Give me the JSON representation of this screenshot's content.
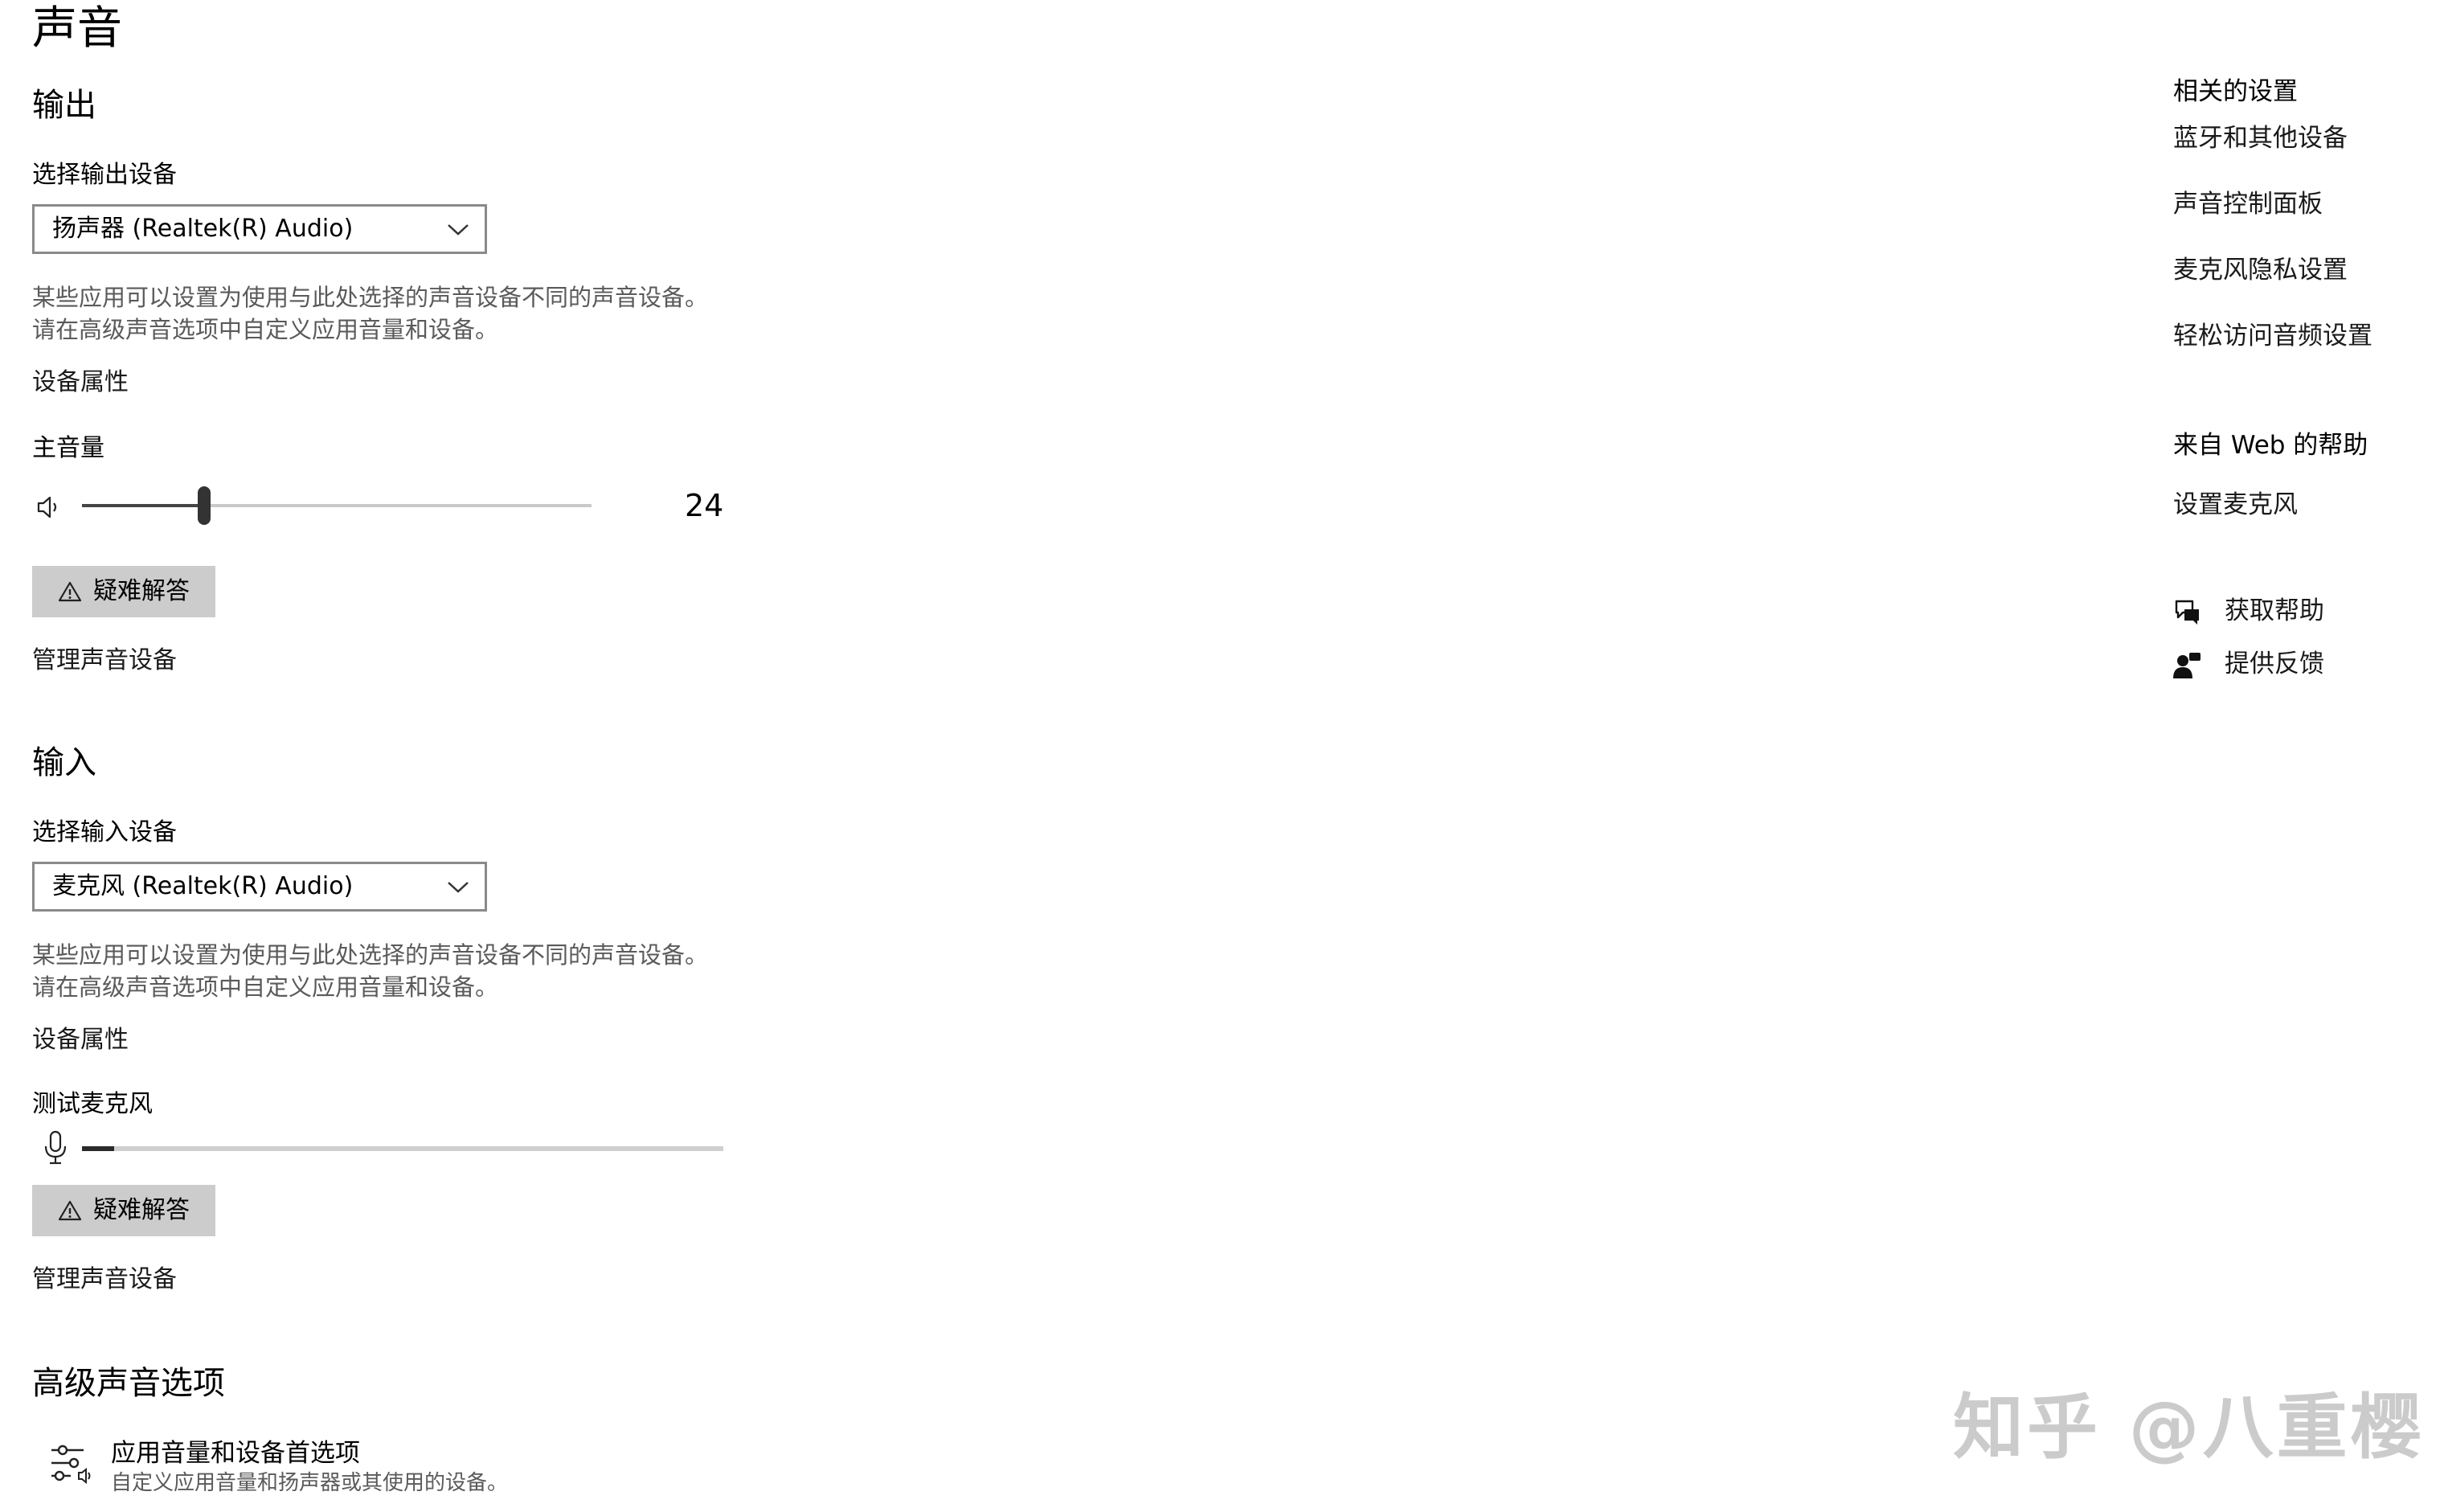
{
  "page": {
    "title": "声音"
  },
  "output": {
    "heading": "输出",
    "select_label": "选择输出设备",
    "selected_device": "扬声器 (Realtek(R) Audio)",
    "desc_line1": "某些应用可以设置为使用与此处选择的声音设备不同的声音设备。",
    "desc_line2": "请在高级声音选项中自定义应用音量和设备。",
    "device_properties": "设备属性",
    "master_volume_label": "主音量",
    "volume_value": "24",
    "volume_level": 24,
    "troubleshoot_label": "疑难解答",
    "manage_devices": "管理声音设备"
  },
  "input": {
    "heading": "输入",
    "select_label": "选择输入设备",
    "selected_device": "麦克风 (Realtek(R) Audio)",
    "desc_line1": "某些应用可以设置为使用与此处选择的声音设备不同的声音设备。",
    "desc_line2": "请在高级声音选项中自定义应用音量和设备。",
    "device_properties": "设备属性",
    "test_mic_label": "测试麦克风",
    "mic_level": 5,
    "troubleshoot_label": "疑难解答",
    "manage_devices": "管理声音设备"
  },
  "advanced": {
    "heading": "高级声音选项",
    "item_title": "应用音量和设备首选项",
    "item_desc": "自定义应用音量和扬声器或其使用的设备。"
  },
  "sidebar": {
    "related_heading": "相关的设置",
    "related_links": [
      "蓝牙和其他设备",
      "声音控制面板",
      "麦克风隐私设置",
      "轻松访问音频设置"
    ],
    "web_help_heading": "来自 Web 的帮助",
    "web_help_links": [
      "设置麦克风"
    ],
    "get_help": "获取帮助",
    "feedback": "提供反馈"
  },
  "watermark": {
    "text": "知乎 @八重樱"
  },
  "icons": {
    "speaker": "speaker-icon",
    "microphone": "microphone-icon",
    "warning": "warning-icon",
    "chevron": "chevron-down-icon",
    "sliders": "sliders-icon",
    "help": "help-chat-icon",
    "feedback": "feedback-person-icon"
  },
  "colors": {
    "button_bg": "#cccccc",
    "slider_fill": "#444444",
    "slider_track": "#c9c9c9",
    "description": "#5a5a5a"
  }
}
